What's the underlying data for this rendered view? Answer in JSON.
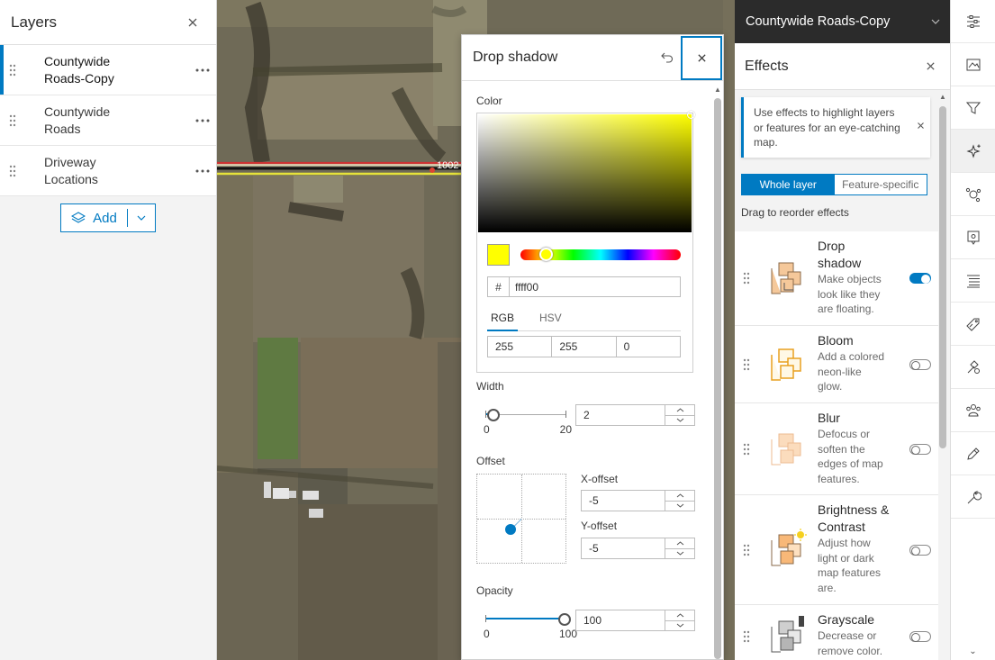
{
  "layers_panel": {
    "title": "Layers",
    "items": [
      {
        "name": "Countywide Roads-Copy",
        "line1": "Countywide",
        "line2": "Roads-Copy",
        "active": true
      },
      {
        "name": "Countywide Roads",
        "line1": "Countywide",
        "line2": "Roads",
        "active": false
      },
      {
        "name": "Driveway Locations",
        "line1": "Driveway",
        "line2": "Locations",
        "active": false
      }
    ],
    "add_label": "Add"
  },
  "map": {
    "road_label": "1002"
  },
  "drop_shadow": {
    "title": "Drop shadow",
    "color_label": "Color",
    "hex_prefix": "#",
    "hex_value": "ffff00",
    "swatch_color": "#ffff00",
    "tabs": [
      "RGB",
      "HSV"
    ],
    "active_tab": "RGB",
    "rgb": [
      "255",
      "255",
      "0"
    ],
    "width_label": "Width",
    "width_value": "2",
    "width_min": "0",
    "width_max": "20",
    "offset_label": "Offset",
    "x_offset_label": "X-offset",
    "x_offset_value": "-5",
    "y_offset_label": "Y-offset",
    "y_offset_value": "-5",
    "opacity_label": "Opacity",
    "opacity_value": "100",
    "opacity_min": "0",
    "opacity_max": "100"
  },
  "layer_header": {
    "title": "Countywide Roads-Copy"
  },
  "effects": {
    "title": "Effects",
    "notice": "Use effects to highlight layers or features for an eye-catching map.",
    "segments": [
      "Whole layer",
      "Feature-specific"
    ],
    "active_segment": "Whole layer",
    "drag_hint": "Drag to reorder effects",
    "items": [
      {
        "name": "Drop shadow",
        "n1": "Drop",
        "n2": "shadow",
        "desc": "Make objects look like they are floating.",
        "d1": "Make objects",
        "d2": "look like they",
        "d3": "are floating.",
        "enabled": true
      },
      {
        "name": "Bloom",
        "n1": "Bloom",
        "n2": "",
        "desc": "Add a colored neon-like glow.",
        "d1": "Add a colored",
        "d2": "neon-like",
        "d3": "glow.",
        "enabled": false
      },
      {
        "name": "Blur",
        "n1": "Blur",
        "n2": "",
        "desc": "Defocus or soften the edges of map features.",
        "d1": "Defocus or",
        "d2": "soften the",
        "d3": "edges of map",
        "d4": "features.",
        "enabled": false
      },
      {
        "name": "Brightness & Contrast",
        "n1": "Brightness &",
        "n2": "Contrast",
        "desc": "Adjust how light or dark map features are.",
        "d1": "Adjust how",
        "d2": "light or dark",
        "d3": "map features",
        "d4": "are.",
        "enabled": false
      },
      {
        "name": "Grayscale",
        "n1": "Grayscale",
        "n2": "",
        "desc": "Decrease or remove color.",
        "d1": "Decrease or",
        "d2": "remove color.",
        "enabled": false
      }
    ]
  },
  "toolbar": {
    "tools": [
      "properties-icon",
      "styles-icon",
      "filter-icon",
      "effects-icon",
      "clustering-icon",
      "pop-ups-icon",
      "fields-icon",
      "labels-icon",
      "configure-icon",
      "forms-icon",
      "edit-icon",
      "settings-wrench-icon"
    ],
    "active": "effects-icon"
  },
  "colors": {
    "accent": "#007ac2",
    "dark_header": "#2b2b2b"
  }
}
